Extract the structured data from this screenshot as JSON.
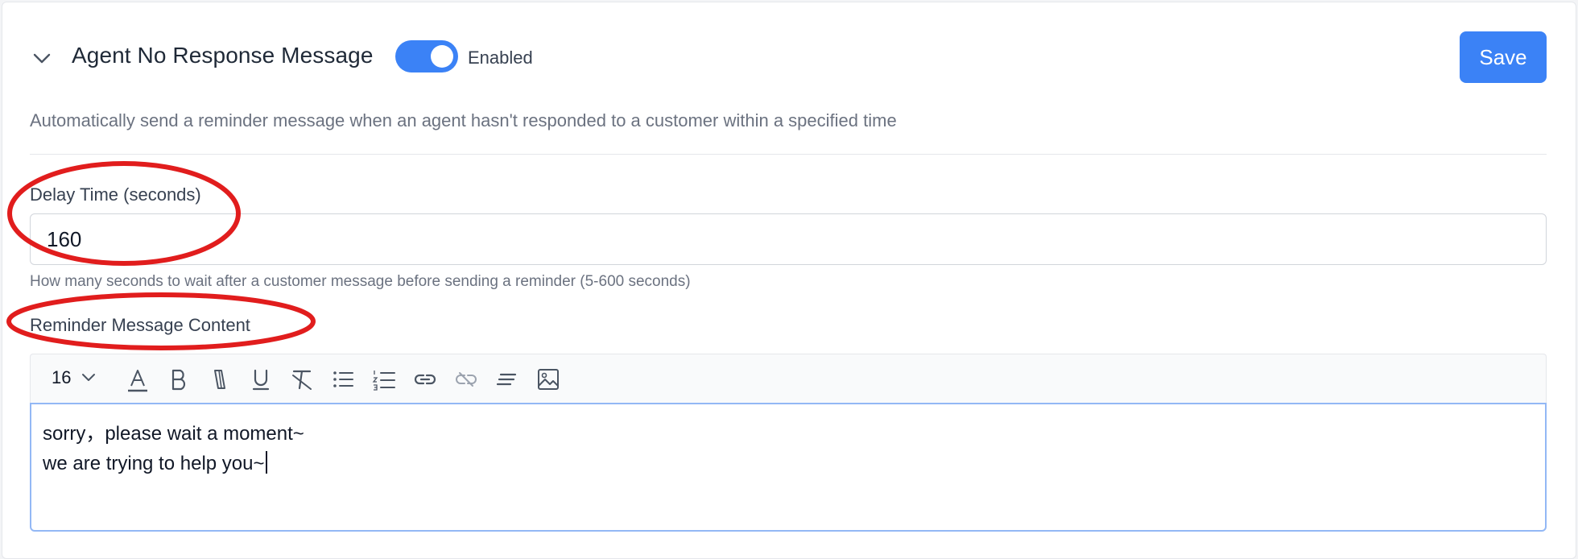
{
  "header": {
    "title": "Agent No Response Message",
    "toggle_state": "on",
    "toggle_label": "Enabled",
    "save_label": "Save",
    "accent_color": "#3b82f6"
  },
  "description": "Automatically send a reminder message when an agent hasn't responded to a customer within a specified time",
  "delay": {
    "label": "Delay Time (seconds)",
    "value": "160",
    "hint": "How many seconds to wait after a customer message before sending a reminder (5-600 seconds)"
  },
  "content": {
    "label": "Reminder Message Content",
    "font_size": "16",
    "toolbar_icons": [
      "font-color-icon",
      "bold-icon",
      "italic-icon",
      "underline-icon",
      "clear-format-icon",
      "bullet-list-icon",
      "numbered-list-icon",
      "link-icon",
      "unlink-icon",
      "align-icon",
      "image-icon"
    ],
    "lines": [
      "sorry，please wait a moment~",
      "we are trying to help you~"
    ]
  },
  "annotations": {
    "highlight_color": "#e11d1d"
  }
}
